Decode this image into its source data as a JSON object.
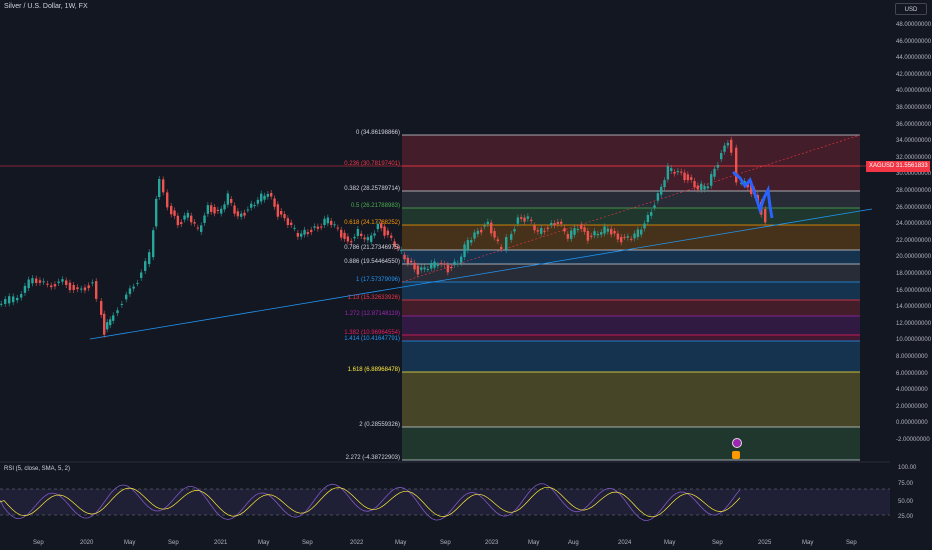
{
  "header": {
    "title": "Silver / U.S. Dollar, 1W, FX",
    "currency": "USD"
  },
  "price_tag": {
    "symbol": "XAGUSD",
    "price": "31.5561833"
  },
  "y_axis": [
    "48.00000000",
    "46.00000000",
    "44.00000000",
    "42.00000000",
    "40.00000000",
    "38.00000000",
    "36.00000000",
    "34.00000000",
    "32.00000000",
    "30.00000000",
    "28.00000000",
    "26.00000000",
    "24.00000000",
    "22.00000000",
    "20.00000000",
    "18.00000000",
    "16.00000000",
    "14.00000000",
    "12.00000000",
    "10.00000000",
    "8.00000000",
    "6.00000000",
    "4.00000000",
    "2.00000000",
    "0.00000000",
    "-2.00000000"
  ],
  "fib_levels": [
    {
      "label": "0 (34.86198866)",
      "color": "#d1d4dc"
    },
    {
      "label": "0.236 (30.78197401)",
      "color": "#f23645"
    },
    {
      "label": "0.382 (28.25789714)",
      "color": "#d1d4dc"
    },
    {
      "label": "0.5 (26.21788983)",
      "color": "#4caf50"
    },
    {
      "label": "0.618 (24.17788252)",
      "color": "#ff9800"
    },
    {
      "label": "0.786 (21.27346975)",
      "color": "#d1d4dc"
    },
    {
      "label": "0.886 (19.54464550)",
      "color": "#d1d4dc"
    },
    {
      "label": "1 (17.57379096)",
      "color": "#2196f3"
    },
    {
      "label": "1.13 (15.32633926)",
      "color": "#f23645"
    },
    {
      "label": "1.272 (12.87148119)",
      "color": "#9c27b0"
    },
    {
      "label": "1.382 (10.96964554)",
      "color": "#e91e63"
    },
    {
      "label": "1.414 (10.41647791)",
      "color": "#2196f3"
    },
    {
      "label": "1.618 (6.88968478)",
      "color": "#ffeb3b"
    },
    {
      "label": "2 (0.28559326)",
      "color": "#d1d4dc"
    },
    {
      "label": "2.272 (-4.38722903)",
      "color": "#d1d4dc"
    }
  ],
  "rsi": {
    "title": "RSI (5, close, SMA, 5, 2)",
    "labels": [
      "100.00",
      "75.00",
      "50.00",
      "25.00"
    ]
  },
  "x_axis": [
    "Sep",
    "2020",
    "May",
    "Sep",
    "2021",
    "May",
    "Sep",
    "2022",
    "May",
    "Sep",
    "2023",
    "May",
    "Aug",
    "2024",
    "May",
    "Sep",
    "2025",
    "May",
    "Sep"
  ],
  "colors": {
    "up": "#26a69a",
    "down": "#ef5350",
    "background": "#131722"
  }
}
